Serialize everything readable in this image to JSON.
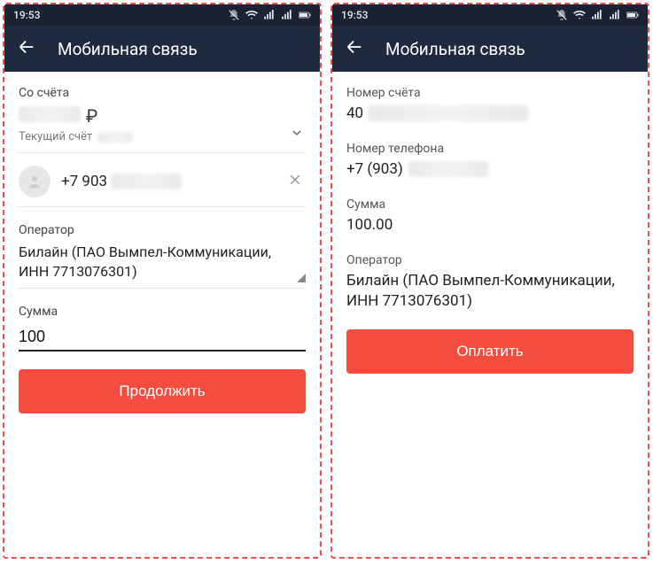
{
  "status": {
    "time": "19:53",
    "mute": "mute-icon",
    "wifi": "wifi-icon",
    "signal1": "signal-icon",
    "signal2": "signal-icon",
    "battery": "battery-icon"
  },
  "screen1": {
    "title": "Мобильная связь",
    "from_account_label": "Со счёта",
    "currency": "₽",
    "current_account_label": "Текущий счёт",
    "phone_display": "+7 903",
    "operator_label": "Оператор",
    "operator_value": "Билайн (ПАО Вымпел-Коммуникации, ИНН 7713076301)",
    "sum_label": "Сумма",
    "sum_value": "100",
    "continue_btn": "Продолжить"
  },
  "screen2": {
    "title": "Мобильная связь",
    "account_label": "Номер счёта",
    "account_prefix": "40",
    "phone_label": "Номер телефона",
    "phone_prefix": "+7 (903)",
    "sum_label": "Сумма",
    "sum_value": "100.00",
    "operator_label": "Оператор",
    "operator_value": "Билайн (ПАО Вымпел-Коммуникации, ИНН 7713076301)",
    "pay_btn": "Оплатить"
  }
}
